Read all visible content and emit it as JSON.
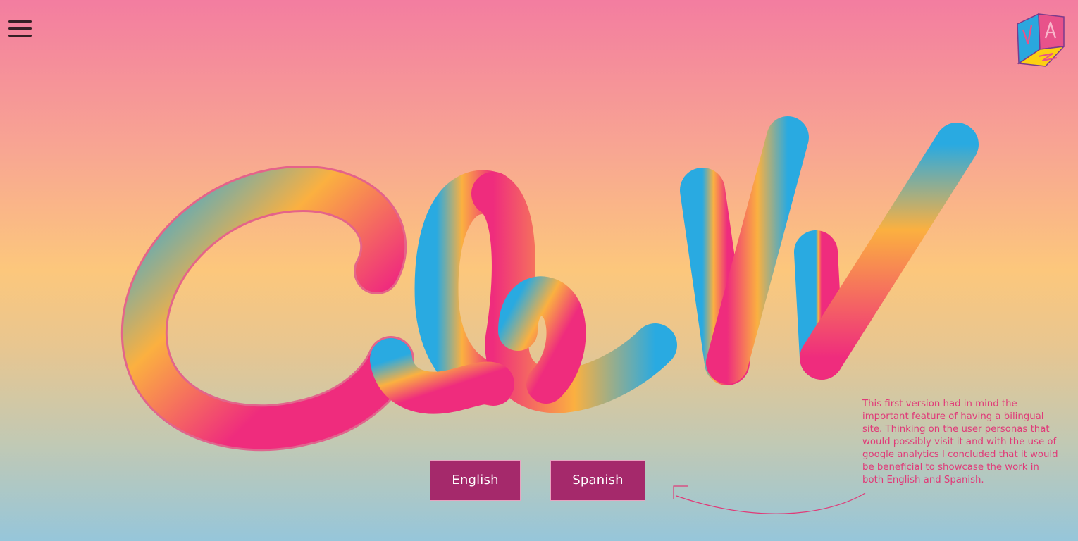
{
  "header": {
    "menu_icon": "hamburger-menu-icon",
    "logo_icon": "va-cube-logo-icon"
  },
  "hero": {
    "lettering_icon": "cbw-script-lettering"
  },
  "language_buttons": {
    "english_label": "English",
    "spanish_label": "Spanish"
  },
  "annotation": {
    "text": "This first version had in mind the important feature of having a bilingual site. Thinking on the user personas that would possibly visit it and with the use of google analytics I concluded that it would be beneficial to showcase the work in both English and Spanish."
  },
  "colors": {
    "button_bg": "#a5296b",
    "note_text": "#e03a78",
    "menu_icon": "#352025",
    "gradient_top": "#f37da0",
    "gradient_mid": "#fcc77c",
    "gradient_bottom": "#96c6da",
    "stroke_blue": "#29aae1",
    "stroke_orange": "#fbb040",
    "stroke_pink": "#ef2c7d"
  }
}
